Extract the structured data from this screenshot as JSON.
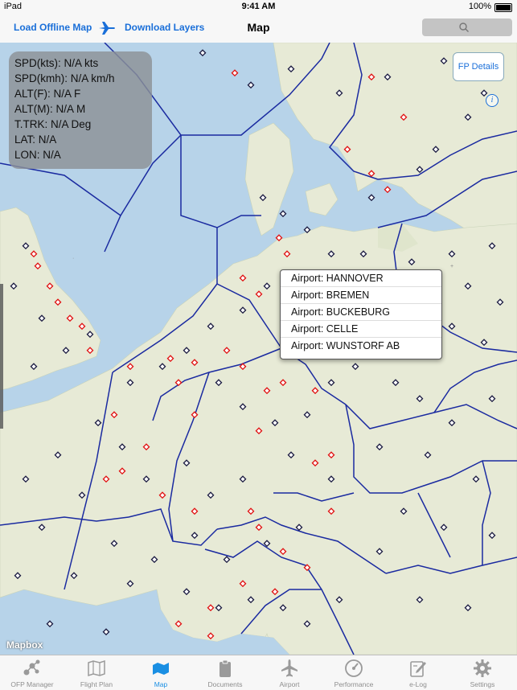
{
  "status_bar": {
    "carrier": "iPad",
    "time": "9:41 AM",
    "battery": "100%"
  },
  "nav": {
    "load_offline_map": "Load Offline Map",
    "download_layers": "Download Layers",
    "title": "Map",
    "search_icon": "search-icon",
    "plane_icon": "airplane-icon"
  },
  "info_panel": {
    "spd_kts": "SPD(kts): N/A kts",
    "spd_kmh": "SPD(kmh): N/A km/h",
    "alt_f": "ALT(F): N/A F",
    "alt_m": "ALT(M): N/A M",
    "ttrk": "T.TRK: N/A Deg",
    "lat": "LAT: N/A",
    "lon": "LON: N/A"
  },
  "fp_details": "FP Details",
  "airport_popup": {
    "items": [
      "Airport: HANNOVER",
      "Airport: BREMEN",
      "Airport: BUCKEBURG",
      "Airport: CELLE",
      "Airport: WUNSTORF AB"
    ]
  },
  "map": {
    "attribution": "Mapbox",
    "water_color": "#b7d3e9",
    "land_color": "#e8ebd8",
    "boundary_color": "#1a2aa0"
  },
  "tabs": [
    {
      "label": "OFP Manager",
      "icon": "molecule-icon"
    },
    {
      "label": "Flight Plan",
      "icon": "map-fold-icon"
    },
    {
      "label": "Map",
      "icon": "map-icon",
      "active": true
    },
    {
      "label": "Documents",
      "icon": "clipboard-icon"
    },
    {
      "label": "Airport",
      "icon": "airplane-icon"
    },
    {
      "label": "Performance",
      "icon": "gauge-icon"
    },
    {
      "label": "e-Log",
      "icon": "edit-log-icon"
    },
    {
      "label": "Settings",
      "icon": "gear-icon"
    }
  ]
}
